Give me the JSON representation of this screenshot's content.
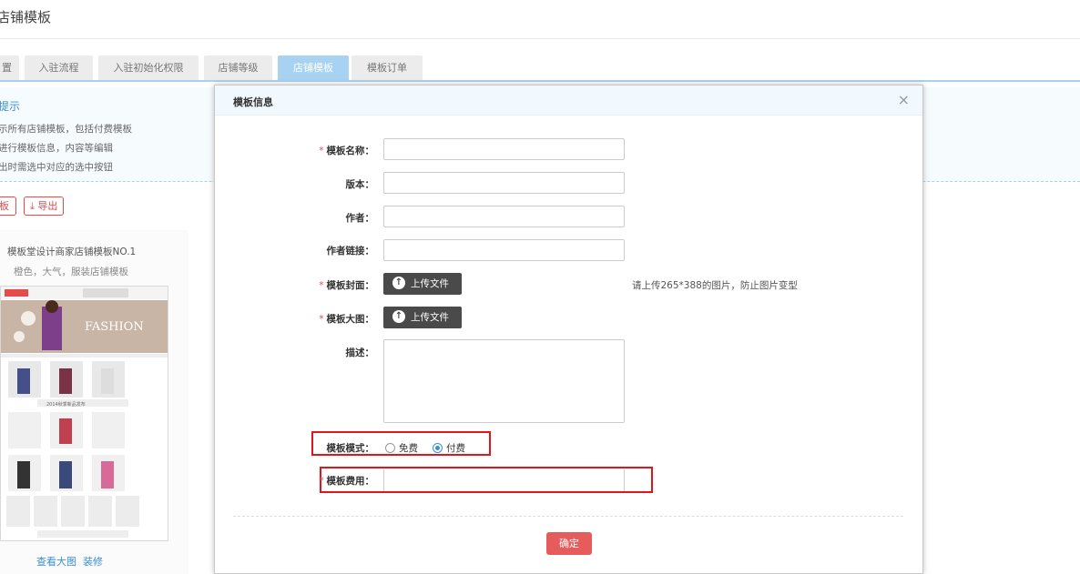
{
  "page": {
    "title": "店铺模板"
  },
  "tabs": [
    {
      "label": "置"
    },
    {
      "label": "入驻流程"
    },
    {
      "label": "入驻初始化权限"
    },
    {
      "label": "店铺等级"
    },
    {
      "label": "店铺模板"
    },
    {
      "label": "模板订单"
    }
  ],
  "tips": {
    "title": "提示",
    "lines": [
      "示所有店铺模板，包括付费模板",
      "进行模板信息，内容等编辑",
      "出时需选中对应的选中按钮"
    ]
  },
  "actions": {
    "add_label": "板",
    "export_label": "导出"
  },
  "template_card": {
    "title": "模板堂设计商家店铺模板NO.1",
    "subtitle": "橙色，大气，服装店铺模板",
    "thumb_brand": "FASHION",
    "thumb_caption": "2014秋季新品发布",
    "view_large": "查看大图",
    "decorate": "装修"
  },
  "modal": {
    "title": "模板信息",
    "close_glyph": "×",
    "required_mark": "*",
    "fields": {
      "name": {
        "label": "模板名称：",
        "value": ""
      },
      "version": {
        "label": "版本：",
        "value": ""
      },
      "author": {
        "label": "作者：",
        "value": ""
      },
      "author_link": {
        "label": "作者链接：",
        "value": ""
      },
      "cover": {
        "label": "模板封面："
      },
      "large_image": {
        "label": "模板大图："
      },
      "description": {
        "label": "描述：",
        "value": ""
      },
      "mode": {
        "label": "模板模式：",
        "options": [
          "免费",
          "付费"
        ],
        "selected": "付费"
      },
      "fee": {
        "label": "模板费用：",
        "value": ""
      }
    },
    "upload_label": "上传文件",
    "upload_icon": "upload-icon",
    "upload_hint": "请上传265*388的图片，防止图片变型",
    "confirm_label": "确定"
  },
  "colors": {
    "accent": "#3a8fd3",
    "tab_active": "#a8d2f1",
    "danger": "#e44b4b",
    "confirm": "#e65c5c",
    "highlight_frame": "#e0161b",
    "upload_button": "#4a4a4a"
  }
}
